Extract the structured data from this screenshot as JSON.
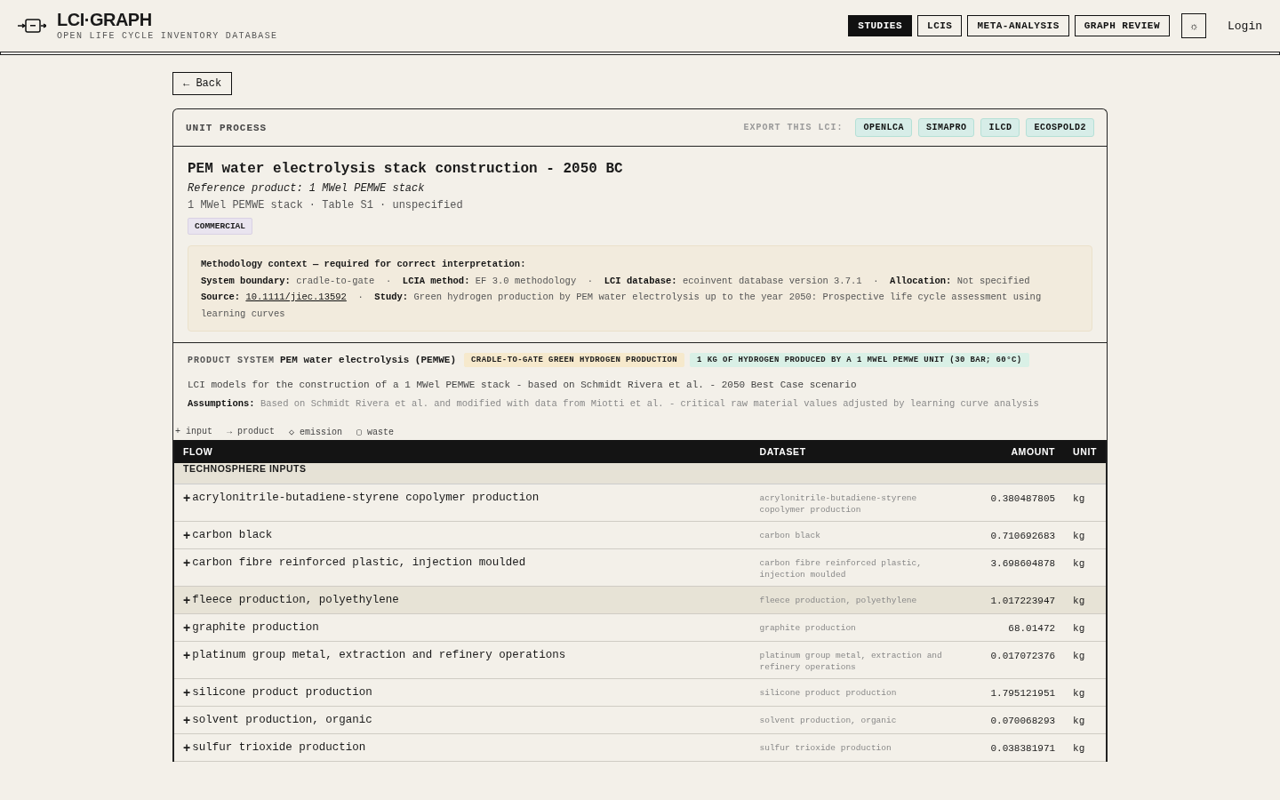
{
  "header": {
    "brand": "LCI·GRAPH",
    "tagline": "OPEN LIFE CYCLE INVENTORY DATABASE",
    "nav": [
      {
        "label": "STUDIES",
        "selected": true
      },
      {
        "label": "LCIS",
        "selected": false
      },
      {
        "label": "META-ANALYSIS",
        "selected": false
      },
      {
        "label": "GRAPH REVIEW",
        "selected": false
      }
    ],
    "theme_toggle": "☼",
    "login": "Login"
  },
  "back": "← Back",
  "process": {
    "kind_label": "UNIT PROCESS",
    "export_label": "EXPORT THIS LCI:",
    "exports": [
      "OPENLCA",
      "SIMAPRO",
      "ILCD",
      "ECOSPOLD2"
    ],
    "title": "PEM water electrolysis stack construction - 2050 BC",
    "reference": "Reference product: 1 MWel PEMWE stack",
    "meta": "1 MWel PEMWE stack · Table S1 · unspecified",
    "badge": "COMMERCIAL",
    "methodology": {
      "heading": "Methodology context — required for correct interpretation:",
      "line": "**System boundary:** cradle-to-gate  ·  **LCIA method:** EF 3.0 methodology  ·  **LCI database:** ecoinvent database version 3.7.1  ·  **Allocation:** Not specified",
      "source_label": "Source:",
      "source_link": "10.1111/jiec.13592",
      "study": "  ·  **Study:** Green hydrogen production by PEM water electrolysis up to the year 2050: Prospective life cycle assessment using learning curves"
    },
    "product_system": {
      "label": "PRODUCT SYSTEM",
      "name": "PEM water electrolysis (PEMWE)",
      "tags": [
        {
          "text": "CRADLE-TO-GATE GREEN HYDROGEN PRODUCTION",
          "color": "#f6e9cc"
        },
        {
          "text": "1 KG OF HYDROGEN PRODUCED BY A 1 MWEL PEMWE UNIT (30 BAR; 60°C)",
          "color": "#d9f0e6"
        }
      ],
      "description": "LCI models for the construction of a 1 MWel PEMWE stack - based on Schmidt Rivera et al. - 2050 Best Case scenario",
      "assumptions": "**Assumptions:** Based on Schmidt Rivera et al. and modified with data from Miotti et al. - critical raw material values adjusted by learning curve analysis"
    }
  },
  "legend": [
    {
      "symbol": "+",
      "label": "input"
    },
    {
      "symbol": "→",
      "label": "product"
    },
    {
      "symbol": "◇",
      "label": "emission"
    },
    {
      "symbol": "▢",
      "label": "waste"
    }
  ],
  "table": {
    "columns": [
      "FLOW",
      "DATASET",
      "AMOUNT",
      "UNIT"
    ],
    "section": "TECHNOSPHERE INPUTS",
    "rows": [
      {
        "symbol": "+",
        "flow": "acrylonitrile-butadiene-styrene copolymer production",
        "dataset": "acrylonitrile-butadiene-styrene copolymer production",
        "amount": "0.380487805",
        "unit": "kg",
        "selected": false
      },
      {
        "symbol": "+",
        "flow": "carbon black",
        "dataset": "carbon black",
        "amount": "0.710692683",
        "unit": "kg",
        "selected": false
      },
      {
        "symbol": "+",
        "flow": "carbon fibre reinforced plastic, injection moulded",
        "dataset": "carbon fibre reinforced plastic, injection moulded",
        "amount": "3.698604878",
        "unit": "kg",
        "selected": false
      },
      {
        "symbol": "+",
        "flow": "fleece production, polyethylene",
        "dataset": "fleece production, polyethylene",
        "amount": "1.017223947",
        "unit": "kg",
        "selected": true
      },
      {
        "symbol": "+",
        "flow": "graphite production",
        "dataset": "graphite production",
        "amount": "68.01472",
        "unit": "kg",
        "selected": false
      },
      {
        "symbol": "+",
        "flow": "platinum group metal, extraction and refinery operations",
        "dataset": "platinum group metal, extraction and refinery operations",
        "amount": "0.017072376",
        "unit": "kg",
        "selected": false
      },
      {
        "symbol": "+",
        "flow": "silicone product production",
        "dataset": "silicone product production",
        "amount": "1.795121951",
        "unit": "kg",
        "selected": false
      },
      {
        "symbol": "+",
        "flow": "solvent production, organic",
        "dataset": "solvent production, organic",
        "amount": "0.070068293",
        "unit": "kg",
        "selected": false
      },
      {
        "symbol": "+",
        "flow": "sulfur trioxide production",
        "dataset": "sulfur trioxide production",
        "amount": "0.038381971",
        "unit": "kg",
        "selected": false
      }
    ]
  }
}
